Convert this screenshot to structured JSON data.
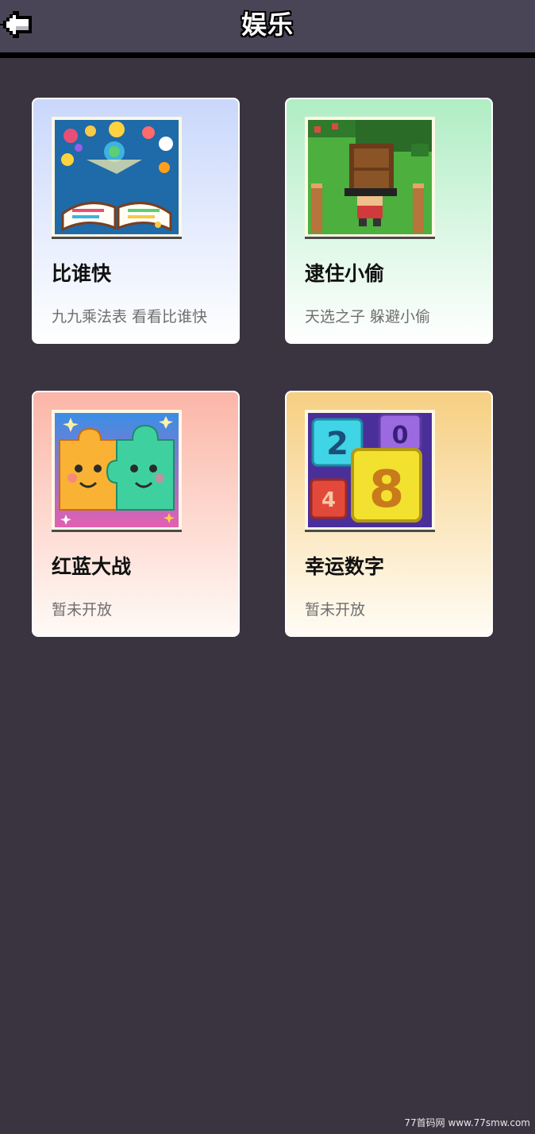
{
  "header": {
    "title": "娱乐",
    "back_icon": "back-arrow-icon"
  },
  "games": [
    {
      "title": "比谁快",
      "description": "九九乘法表 看看比谁快",
      "icon": "open-book-icon",
      "accent": "#c9d7fb"
    },
    {
      "title": "逮住小偷",
      "description": "天选之子 躲避小偷",
      "icon": "pixel-thief-icon",
      "accent": "#b0edc4"
    },
    {
      "title": "红蓝大战",
      "description": "暂未开放",
      "icon": "puzzle-pieces-icon",
      "accent": "#fbb6a8"
    },
    {
      "title": "幸运数字",
      "description": "暂未开放",
      "icon": "number-blocks-icon",
      "accent": "#f6cf82",
      "thumb_digits": [
        "2",
        "0",
        "8",
        "4"
      ]
    }
  ],
  "watermark": "77首码网 www.77smw.com",
  "colors": {
    "background": "#3a3441",
    "header": "#4a4556"
  }
}
